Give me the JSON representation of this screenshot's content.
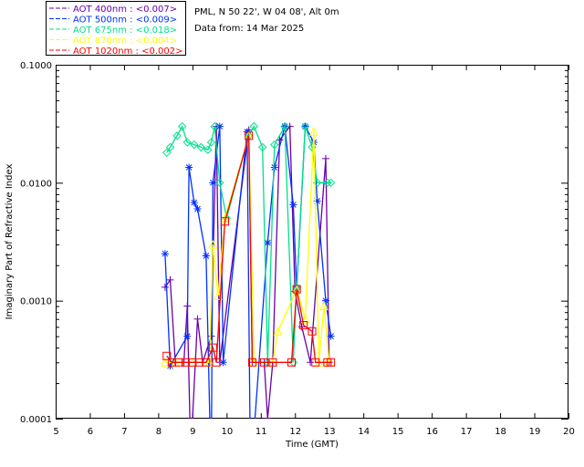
{
  "header": {
    "site": "PML, N 50 22', W 04 08', Alt 0m",
    "date": "Data from: 14 Mar 2025"
  },
  "chart_data": {
    "type": "line",
    "title": "",
    "xlabel": "Time (GMT)",
    "ylabel": "Imaginary Part of Refractive Index",
    "xlim": [
      5,
      20
    ],
    "ylim": [
      0.0001,
      0.1
    ],
    "yscale": "log",
    "grid": false,
    "legend_position": "top-left-outside",
    "xticks": [
      "5",
      "6",
      "7",
      "8",
      "9",
      "10",
      "11",
      "12",
      "13",
      "14",
      "15",
      "16",
      "17",
      "18",
      "19",
      "20"
    ],
    "yticks": [
      "0.0001",
      "0.0010",
      "0.0100",
      "0.1000"
    ],
    "series": [
      {
        "name": "AOT  400nm : <0.007>",
        "color": "#6a00a8",
        "marker": "plus",
        "points": [
          [
            8.2,
            0.0013
          ],
          [
            8.35,
            0.0015
          ],
          [
            8.5,
            0.0003
          ],
          [
            8.75,
            0.0003
          ],
          [
            8.85,
            0.0009
          ],
          [
            8.95,
            5e-05
          ],
          [
            9.15,
            0.0007
          ],
          [
            9.3,
            0.0003
          ],
          [
            9.55,
            0.0005
          ],
          [
            9.7,
            0.03
          ],
          [
            9.8,
            0.0003
          ],
          [
            10.65,
            0.028
          ],
          [
            10.75,
            0.0003
          ],
          [
            11.1,
            0.0003
          ],
          [
            11.2,
            0.0001
          ],
          [
            11.35,
            0.0003
          ],
          [
            11.55,
            0.023
          ],
          [
            11.85,
            0.03
          ],
          [
            12.0,
            0.0012
          ],
          [
            12.2,
            0.0006
          ],
          [
            12.45,
            0.0003
          ],
          [
            12.9,
            0.016
          ],
          [
            13.0,
            0.0003
          ]
        ]
      },
      {
        "name": "AOT  500nm : <0.009>",
        "color": "#0030ff",
        "marker": "asterisk",
        "points": [
          [
            8.2,
            0.0025
          ],
          [
            8.35,
            0.00028
          ],
          [
            8.85,
            0.0005
          ],
          [
            8.9,
            0.0135
          ],
          [
            9.05,
            0.0068
          ],
          [
            9.15,
            0.006
          ],
          [
            9.4,
            0.0024
          ],
          [
            9.55,
            3e-05
          ],
          [
            9.6,
            0.01
          ],
          [
            9.8,
            0.03
          ],
          [
            9.9,
            0.0003
          ],
          [
            10.6,
            0.027
          ],
          [
            10.7,
            3e-05
          ],
          [
            11.2,
            0.0031
          ],
          [
            11.4,
            0.0135
          ],
          [
            11.7,
            0.03
          ],
          [
            11.95,
            0.0065
          ],
          [
            12.05,
            0.00125
          ],
          [
            12.3,
            0.03
          ],
          [
            12.55,
            0.022
          ],
          [
            12.65,
            0.007
          ],
          [
            12.9,
            0.001
          ],
          [
            13.05,
            0.0005
          ]
        ]
      },
      {
        "name": "AOT  675nm : <0.018>",
        "color": "#00e08a",
        "marker": "diamond",
        "points": [
          [
            8.25,
            0.018
          ],
          [
            8.35,
            0.02
          ],
          [
            8.55,
            0.025
          ],
          [
            8.7,
            0.03
          ],
          [
            8.85,
            0.022
          ],
          [
            9.05,
            0.021
          ],
          [
            9.25,
            0.02
          ],
          [
            9.45,
            0.019
          ],
          [
            9.55,
            0.022
          ],
          [
            9.65,
            0.03
          ],
          [
            9.8,
            0.01
          ],
          [
            10.0,
            0.005
          ],
          [
            10.65,
            0.025
          ],
          [
            10.8,
            0.03
          ],
          [
            11.05,
            0.02
          ],
          [
            11.2,
            0.0003
          ],
          [
            11.4,
            0.021
          ],
          [
            11.7,
            0.03
          ],
          [
            11.95,
            0.0003
          ],
          [
            12.05,
            0.0013
          ],
          [
            12.3,
            0.03
          ],
          [
            12.5,
            0.02
          ],
          [
            12.65,
            0.01
          ],
          [
            12.95,
            0.01
          ],
          [
            13.05,
            0.01
          ]
        ]
      },
      {
        "name": "AOT  870nm : <0.004>",
        "color": "#ffff00",
        "marker": "triangle",
        "points": [
          [
            8.2,
            0.0003
          ],
          [
            8.5,
            0.0003
          ],
          [
            9.0,
            0.0003
          ],
          [
            9.5,
            0.0003
          ],
          [
            9.6,
            0.003
          ],
          [
            9.75,
            0.0011
          ],
          [
            9.95,
            0.005
          ],
          [
            10.65,
            0.025
          ],
          [
            10.8,
            0.0003
          ],
          [
            11.35,
            0.0003
          ],
          [
            11.5,
            0.00055
          ],
          [
            12.05,
            0.00125
          ],
          [
            12.3,
            0.0007
          ],
          [
            12.55,
            0.027
          ],
          [
            12.7,
            0.0003
          ],
          [
            12.85,
            0.0009
          ],
          [
            13.0,
            0.0003
          ]
        ]
      },
      {
        "name": "AOT 1020nm : <0.002>",
        "color": "#ff0000",
        "marker": "square",
        "points": [
          [
            8.25,
            0.00034
          ],
          [
            8.4,
            0.0003
          ],
          [
            8.6,
            0.0003
          ],
          [
            8.8,
            0.0003
          ],
          [
            9.0,
            0.0003
          ],
          [
            9.2,
            0.0003
          ],
          [
            9.4,
            0.0003
          ],
          [
            9.6,
            0.0004
          ],
          [
            9.7,
            0.0003
          ],
          [
            9.95,
            0.0047
          ],
          [
            10.65,
            0.025
          ],
          [
            10.75,
            0.0003
          ],
          [
            11.1,
            0.0003
          ],
          [
            11.35,
            0.0003
          ],
          [
            11.9,
            0.0003
          ],
          [
            12.05,
            0.00125
          ],
          [
            12.25,
            0.00062
          ],
          [
            12.5,
            0.00055
          ],
          [
            12.6,
            0.0003
          ],
          [
            12.95,
            0.0003
          ],
          [
            13.05,
            0.0003
          ]
        ]
      }
    ]
  }
}
